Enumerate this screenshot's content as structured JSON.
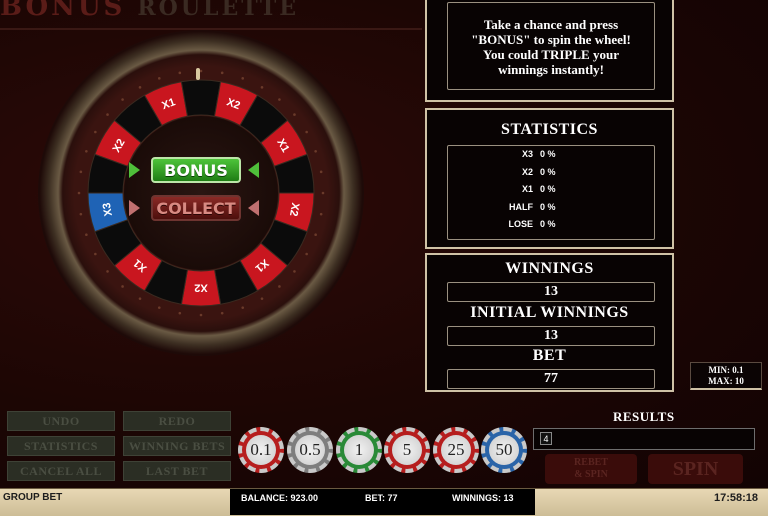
{
  "game": {
    "logo_text": "BONUS",
    "logo_sub": "ROULETTE"
  },
  "info": {
    "line1": "Take a chance and press",
    "line2": "\"BONUS\" to spin the wheel!",
    "line3": "You could TRIPLE your",
    "line4": "winnings instantly!"
  },
  "statistics": {
    "title": "STATISTICS",
    "rows": [
      {
        "key": "X3",
        "value": "0 %"
      },
      {
        "key": "X2",
        "value": "0 %"
      },
      {
        "key": "X1",
        "value": "0 %"
      },
      {
        "key": "HALF",
        "value": "0 %"
      },
      {
        "key": "LOSE",
        "value": "0 %"
      }
    ]
  },
  "winnings": {
    "label": "WINNINGS",
    "value": "13",
    "initial_label": "INITIAL WINNINGS",
    "initial_value": "13",
    "bet_label": "BET",
    "bet_value": "77"
  },
  "limits": {
    "min": "MIN: 0.1",
    "max": "MAX: 10"
  },
  "wheel": {
    "bonus_label": "BONUS",
    "collect_label": "COLLECT",
    "segments": [
      {
        "label": "X2",
        "color": "#c9161f"
      },
      {
        "label": "X1",
        "color": "#c9161f"
      },
      {
        "label": "X2",
        "color": "#c9161f"
      },
      {
        "label": "X1",
        "color": "#c9161f"
      },
      {
        "label": "X2",
        "color": "#c9161f"
      },
      {
        "label": "X1",
        "color": "#c9161f"
      },
      {
        "label": "X2",
        "color": "#c9161f"
      },
      {
        "label": "X1",
        "color": "#c9161f"
      },
      {
        "label": "X3",
        "color": "#1f63b5"
      }
    ]
  },
  "controls": {
    "undo": "UNDO",
    "redo": "REDO",
    "statistics": "STATISTICS",
    "winning_bets": "WINNING BETS",
    "cancel_all": "CANCEL ALL",
    "last_bet": "LAST BET"
  },
  "chips": [
    {
      "value": "0.1",
      "color": "#b61e1e"
    },
    {
      "value": "0.5",
      "color": "#7e7e7e"
    },
    {
      "value": "1",
      "color": "#2a8a38"
    },
    {
      "value": "5",
      "color": "#b61e1e"
    },
    {
      "value": "25",
      "color": "#b61e1e"
    },
    {
      "value": "50",
      "color": "#2a64a8"
    }
  ],
  "results": {
    "label": "RESULTS",
    "items": [
      "4"
    ]
  },
  "actions": {
    "rebet_line1": "REBET",
    "rebet_line2": "& SPIN",
    "spin": "SPIN"
  },
  "statusbar": {
    "group_bet": "GROUP BET",
    "balance": "BALANCE: 923.00",
    "bet": "BET: 77",
    "winnings": "WINNINGS: 13",
    "clock": "17:58:18"
  }
}
